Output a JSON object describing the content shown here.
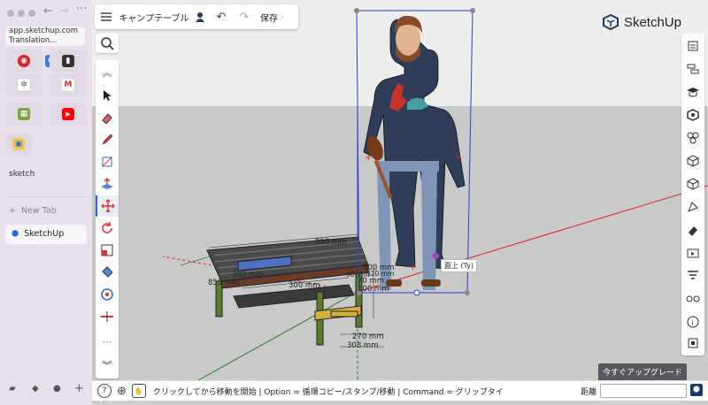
{
  "browser": {
    "url_line1": "app.sketchup.com",
    "url_line2": "Translation...",
    "folder_label": "sketch",
    "new_tab_label": "New Tab",
    "active_tab_label": "SketchUp"
  },
  "toolbar": {
    "model_title": "キャンプテーブル",
    "save_label": "保存"
  },
  "brand": {
    "name": "SketchUp"
  },
  "dimensions": {
    "top_length": "890 mm",
    "side_1": "300 mm",
    "side_2": "320 mm",
    "side_3": "70 mm",
    "side_4": "90 mm",
    "side_5": "100 mm",
    "left": "855 mm",
    "shelf_1": "380 mm",
    "shelf_2": "300 mm",
    "bottom_1": "270 mm",
    "bottom_2": "308 mm"
  },
  "tooltip": "面上 (Ty)",
  "upgrade_label": "今すぐアップグレード",
  "status": {
    "instruction": "クリックしてから移動を開始 | Option = 循環コピー/スタンプ/移動 | Command = グリップタイ",
    "distance_label": "距離",
    "distance_value": ""
  },
  "colors": {
    "accent": "#2a6ad3",
    "selection": "#2b3fd1",
    "ground": "#c9c9c9",
    "sky": "#eeeeee"
  }
}
